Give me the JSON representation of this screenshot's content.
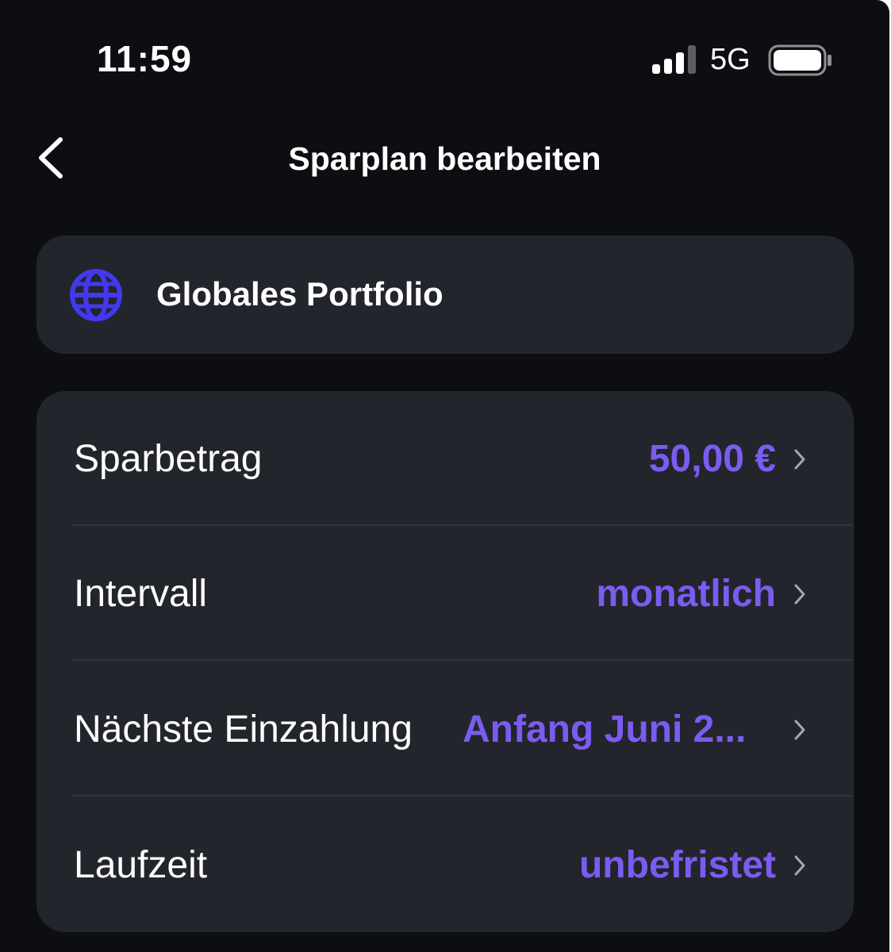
{
  "status_bar": {
    "time": "11:59",
    "network": "5G",
    "signal_icon": "cellular-signal-icon",
    "battery_icon": "battery-icon",
    "signal_bars_filled": 3,
    "signal_bars_total": 4
  },
  "nav": {
    "back_icon": "chevron-left-icon",
    "title": "Sparplan bearbeiten"
  },
  "portfolio": {
    "icon": "globe-icon",
    "name": "Globales Portfolio"
  },
  "settings": {
    "rows": [
      {
        "label": "Sparbetrag",
        "value": "50,00 €",
        "icon": "chevron-right-icon"
      },
      {
        "label": "Intervall",
        "value": "monatlich",
        "icon": "chevron-right-icon"
      },
      {
        "label": "Nächste Einzahlung",
        "value": "Anfang Juni 2...",
        "icon": "chevron-right-icon"
      },
      {
        "label": "Laufzeit",
        "value": "unbefristet",
        "icon": "chevron-right-icon"
      }
    ]
  },
  "colors": {
    "background": "#0d0e11",
    "card": "#23252c",
    "accent": "#7b5cf0",
    "globe": "#4338f0",
    "text": "#ffffff"
  }
}
